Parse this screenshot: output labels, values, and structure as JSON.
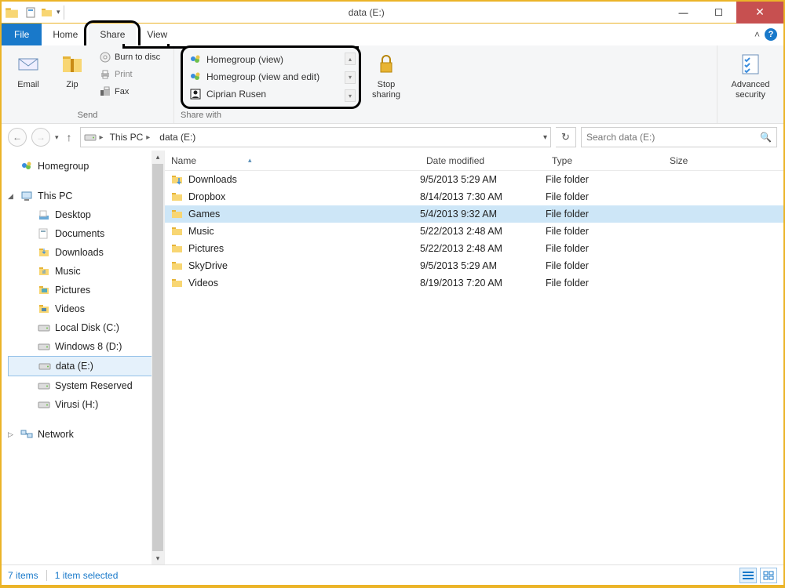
{
  "window": {
    "title": "data (E:)"
  },
  "tabs": {
    "file": "File",
    "home": "Home",
    "share": "Share",
    "view": "View"
  },
  "ribbon": {
    "send": {
      "label": "Send",
      "email": "Email",
      "zip": "Zip",
      "burn": "Burn to disc",
      "print": "Print",
      "fax": "Fax"
    },
    "shareWith": {
      "label": "Share with",
      "items": [
        "Homegroup (view)",
        "Homegroup (view and edit)",
        "Ciprian Rusen"
      ],
      "stop": "Stop sharing"
    },
    "advanced": "Advanced security"
  },
  "addressbar": {
    "crumbs": [
      "This PC",
      "data (E:)"
    ]
  },
  "search": {
    "placeholder": "Search data (E:)"
  },
  "nav": {
    "homegroup": "Homegroup",
    "thispc": "This PC",
    "network": "Network",
    "items": [
      "Desktop",
      "Documents",
      "Downloads",
      "Music",
      "Pictures",
      "Videos",
      "Local Disk (C:)",
      "Windows 8 (D:)",
      "data (E:)",
      "System Reserved",
      "Virusi (H:)"
    ],
    "selectedIndex": 8
  },
  "columns": {
    "name": "Name",
    "date": "Date modified",
    "type": "Type",
    "size": "Size"
  },
  "files": [
    {
      "name": "Downloads",
      "date": "9/5/2013 5:29 AM",
      "type": "File folder"
    },
    {
      "name": "Dropbox",
      "date": "8/14/2013 7:30 AM",
      "type": "File folder"
    },
    {
      "name": "Games",
      "date": "5/4/2013 9:32 AM",
      "type": "File folder",
      "selected": true
    },
    {
      "name": "Music",
      "date": "5/22/2013 2:48 AM",
      "type": "File folder"
    },
    {
      "name": "Pictures",
      "date": "5/22/2013 2:48 AM",
      "type": "File folder"
    },
    {
      "name": "SkyDrive",
      "date": "9/5/2013 5:29 AM",
      "type": "File folder"
    },
    {
      "name": "Videos",
      "date": "8/19/2013 7:20 AM",
      "type": "File folder"
    }
  ],
  "status": {
    "count": "7 items",
    "selected": "1 item selected"
  }
}
